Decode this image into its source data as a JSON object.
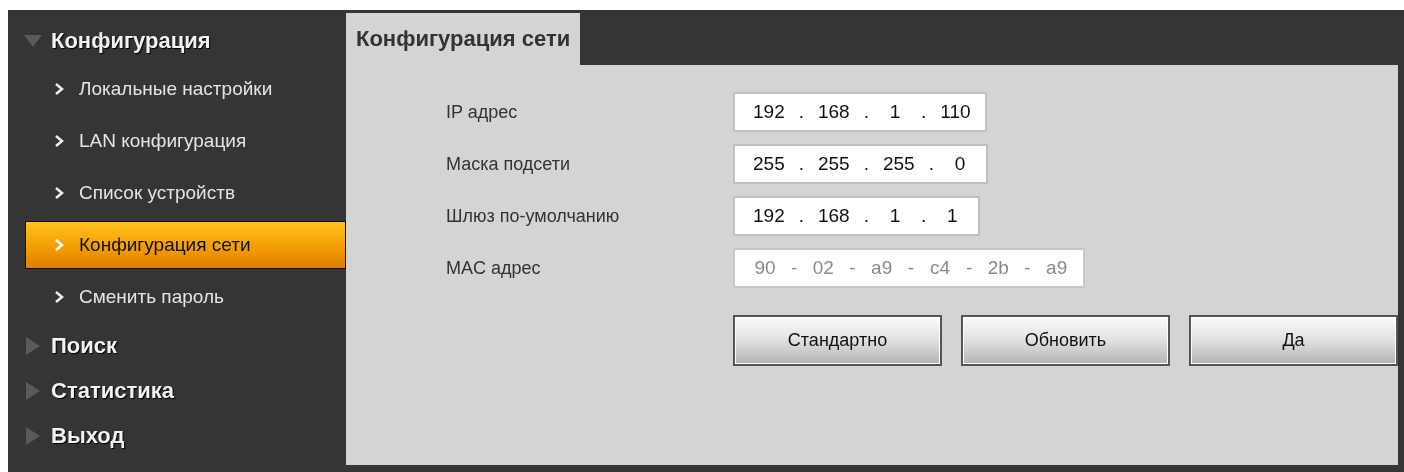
{
  "sidebar": {
    "sections": [
      {
        "label": "Конфигурация",
        "expanded": true,
        "items": [
          {
            "label": "Локальные настройки",
            "selected": false
          },
          {
            "label": "LAN конфигурация",
            "selected": false
          },
          {
            "label": "Список устройств",
            "selected": false
          },
          {
            "label": "Конфигурация сети",
            "selected": true
          },
          {
            "label": "Сменить пароль",
            "selected": false
          }
        ]
      },
      {
        "label": "Поиск",
        "expanded": false
      },
      {
        "label": "Статистика",
        "expanded": false
      },
      {
        "label": "Выход",
        "expanded": false
      }
    ]
  },
  "tabs": [
    {
      "label": "Конфигурация сети",
      "selected": true
    }
  ],
  "form": {
    "fields": [
      {
        "label": "IP адрес",
        "separator": ".",
        "parts": [
          "192",
          "168",
          "1",
          "110"
        ],
        "disabled": false
      },
      {
        "label": "Маска подсети",
        "separator": ".",
        "parts": [
          "255",
          "255",
          "255",
          "0"
        ],
        "disabled": false
      },
      {
        "label": "Шлюз по-умолчанию",
        "separator": ".",
        "parts": [
          "192",
          "168",
          "1",
          "1"
        ],
        "disabled": false
      },
      {
        "label": "MAC адрес",
        "separator": "-",
        "parts": [
          "90",
          "02",
          "a9",
          "c4",
          "2b",
          "a9"
        ],
        "disabled": true
      }
    ],
    "buttons": [
      "Стандартно",
      "Обновить",
      "Да"
    ]
  }
}
